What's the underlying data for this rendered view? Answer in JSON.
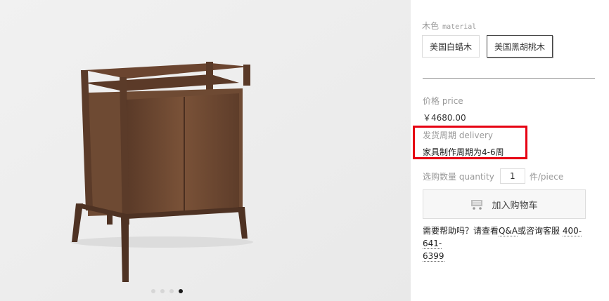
{
  "gallery": {
    "image_alt": "walnut cabinet",
    "dots_count": 4,
    "active_dot": 4
  },
  "material": {
    "label_cn": "木色",
    "label_en": "material",
    "options": [
      "美国白蜡木",
      "美国黑胡桃木"
    ],
    "selected": "美国黑胡桃木"
  },
  "price": {
    "label": "价格 price",
    "value": "￥4680.00"
  },
  "delivery": {
    "label": "发货周期 delivery",
    "text": "家具制作周期为4-6周",
    "highlight_color": "#e60012"
  },
  "quantity": {
    "label": "选购数量 quantity",
    "value": "1",
    "unit": "件/piece"
  },
  "cart": {
    "icon": "cart-icon",
    "label": "加入购物车"
  },
  "help": {
    "prefix": "需要帮助吗？请查看",
    "qa": "Q&A",
    "middle": "或咨询客服",
    "phone_a": "400-641-",
    "phone_b": "6399"
  }
}
